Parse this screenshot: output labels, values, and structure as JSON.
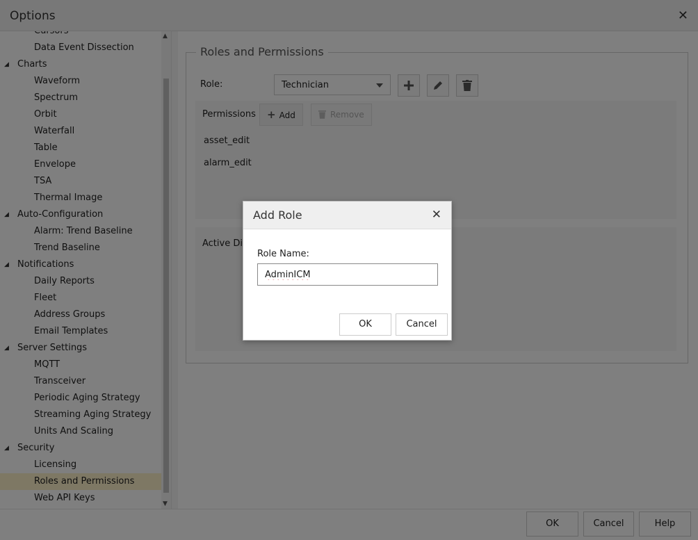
{
  "window": {
    "title": "Options",
    "close_glyph": "✕"
  },
  "sidebar": {
    "items": [
      {
        "label": "Cursors",
        "level": 1
      },
      {
        "label": "Data Event Dissection",
        "level": 1
      },
      {
        "label": "Charts",
        "level": 0
      },
      {
        "label": "Waveform",
        "level": 1
      },
      {
        "label": "Spectrum",
        "level": 1
      },
      {
        "label": "Orbit",
        "level": 1
      },
      {
        "label": "Waterfall",
        "level": 1
      },
      {
        "label": "Table",
        "level": 1
      },
      {
        "label": "Envelope",
        "level": 1
      },
      {
        "label": "TSA",
        "level": 1
      },
      {
        "label": "Thermal Image",
        "level": 1
      },
      {
        "label": "Auto-Configuration",
        "level": 0
      },
      {
        "label": "Alarm: Trend Baseline",
        "level": 1
      },
      {
        "label": "Trend Baseline",
        "level": 1
      },
      {
        "label": "Notifications",
        "level": 0
      },
      {
        "label": "Daily Reports",
        "level": 1
      },
      {
        "label": "Fleet",
        "level": 1
      },
      {
        "label": "Address Groups",
        "level": 1
      },
      {
        "label": "Email Templates",
        "level": 1
      },
      {
        "label": "Server Settings",
        "level": 0
      },
      {
        "label": "MQTT",
        "level": 1
      },
      {
        "label": "Transceiver",
        "level": 1
      },
      {
        "label": "Periodic Aging Strategy",
        "level": 1
      },
      {
        "label": "Streaming Aging Strategy",
        "level": 1
      },
      {
        "label": "Units And Scaling",
        "level": 1
      },
      {
        "label": "Security",
        "level": 0
      },
      {
        "label": "Licensing",
        "level": 1
      },
      {
        "label": "Roles and Permissions",
        "level": 1,
        "selected": true
      },
      {
        "label": "Web API Keys",
        "level": 1
      }
    ]
  },
  "main": {
    "section_title": "Roles and Permissions",
    "role_label": "Role:",
    "role_value": "Technician",
    "permissions": {
      "label": "Permissions",
      "add_label": "Add",
      "remove_label": "Remove",
      "items": [
        "asset_edit",
        "alarm_edit"
      ]
    },
    "active_directory_label": "Active Dir"
  },
  "footer": {
    "ok": "OK",
    "cancel": "Cancel",
    "help": "Help"
  },
  "modal": {
    "title": "Add Role",
    "close_glyph": "✕",
    "field_label": "Role Name:",
    "field_value": "AdminICM",
    "ok": "OK",
    "cancel": "Cancel"
  }
}
